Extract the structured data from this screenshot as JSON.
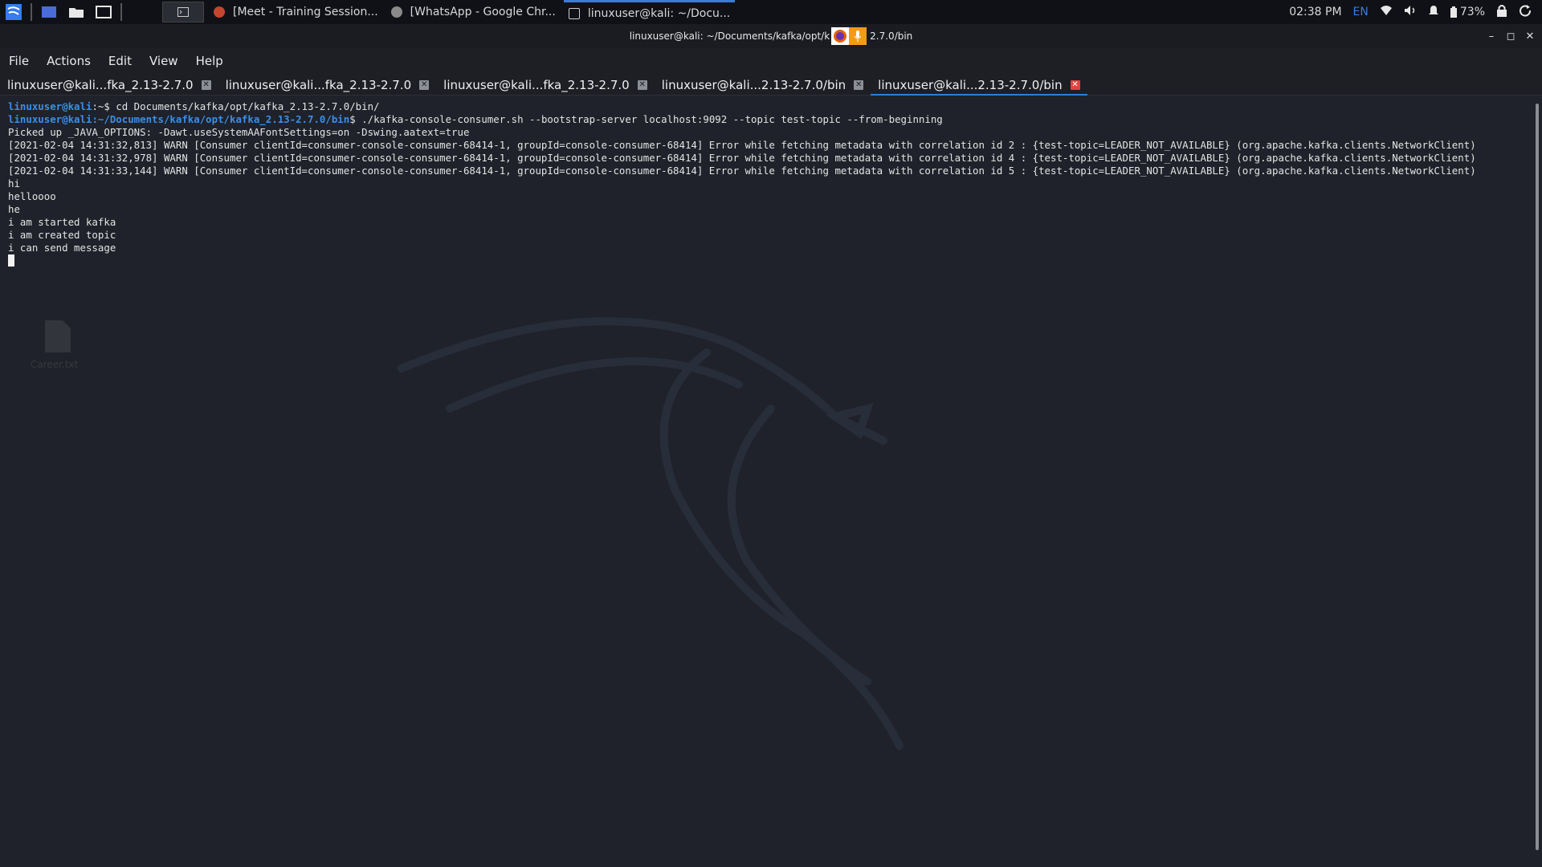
{
  "taskbar": {
    "tasks": [
      {
        "label": "[Meet - Training Session..."
      },
      {
        "label": "[WhatsApp - Google Chr..."
      },
      {
        "label": "linuxuser@kali: ~/Docu..."
      }
    ],
    "clock": "02:38 PM",
    "lang": "EN",
    "battery": "73%"
  },
  "window": {
    "title_left": "linuxuser@kali: ~/Documents/kafka/opt/k",
    "title_right": "2.7.0/bin"
  },
  "menu": [
    "File",
    "Actions",
    "Edit",
    "View",
    "Help"
  ],
  "tabs": [
    {
      "label": "linuxuser@kali...fka_2.13-2.7.0"
    },
    {
      "label": "linuxuser@kali...fka_2.13-2.7.0"
    },
    {
      "label": "linuxuser@kali...fka_2.13-2.7.0"
    },
    {
      "label": "linuxuser@kali...2.13-2.7.0/bin"
    },
    {
      "label": "linuxuser@kali...2.13-2.7.0/bin"
    }
  ],
  "terminal": {
    "prompt_user": "linuxuser@kali",
    "line1_path": ":~$",
    "line1_cmd": " cd Documents/kafka/opt/kafka_2.13-2.7.0/bin/",
    "line2_path": ":~/Documents/kafka/opt/kafka_2.13-2.7.0/bin",
    "line2_dollar": "$",
    "line2_cmd": " ./kafka-console-consumer.sh --bootstrap-server localhost:9092 --topic test-topic --from-beginning",
    "output": [
      "Picked up _JAVA_OPTIONS: -Dawt.useSystemAAFontSettings=on -Dswing.aatext=true",
      "[2021-02-04 14:31:32,813] WARN [Consumer clientId=consumer-console-consumer-68414-1, groupId=console-consumer-68414] Error while fetching metadata with correlation id 2 : {test-topic=LEADER_NOT_AVAILABLE} (org.apache.kafka.clients.NetworkClient)",
      "[2021-02-04 14:31:32,978] WARN [Consumer clientId=consumer-console-consumer-68414-1, groupId=console-consumer-68414] Error while fetching metadata with correlation id 4 : {test-topic=LEADER_NOT_AVAILABLE} (org.apache.kafka.clients.NetworkClient)",
      "[2021-02-04 14:31:33,144] WARN [Consumer clientId=consumer-console-consumer-68414-1, groupId=console-consumer-68414] Error while fetching metadata with correlation id 5 : {test-topic=LEADER_NOT_AVAILABLE} (org.apache.kafka.clients.NetworkClient)",
      "hi",
      "helloooo",
      "he",
      "i am started kafka",
      "i am created topic",
      "i can send message"
    ]
  },
  "desktop": {
    "file_label": "Career.txt"
  },
  "colors": {
    "accent": "#2f7ddb",
    "prompt": "#3b8eea",
    "tab_close_active": "#e0443e"
  }
}
